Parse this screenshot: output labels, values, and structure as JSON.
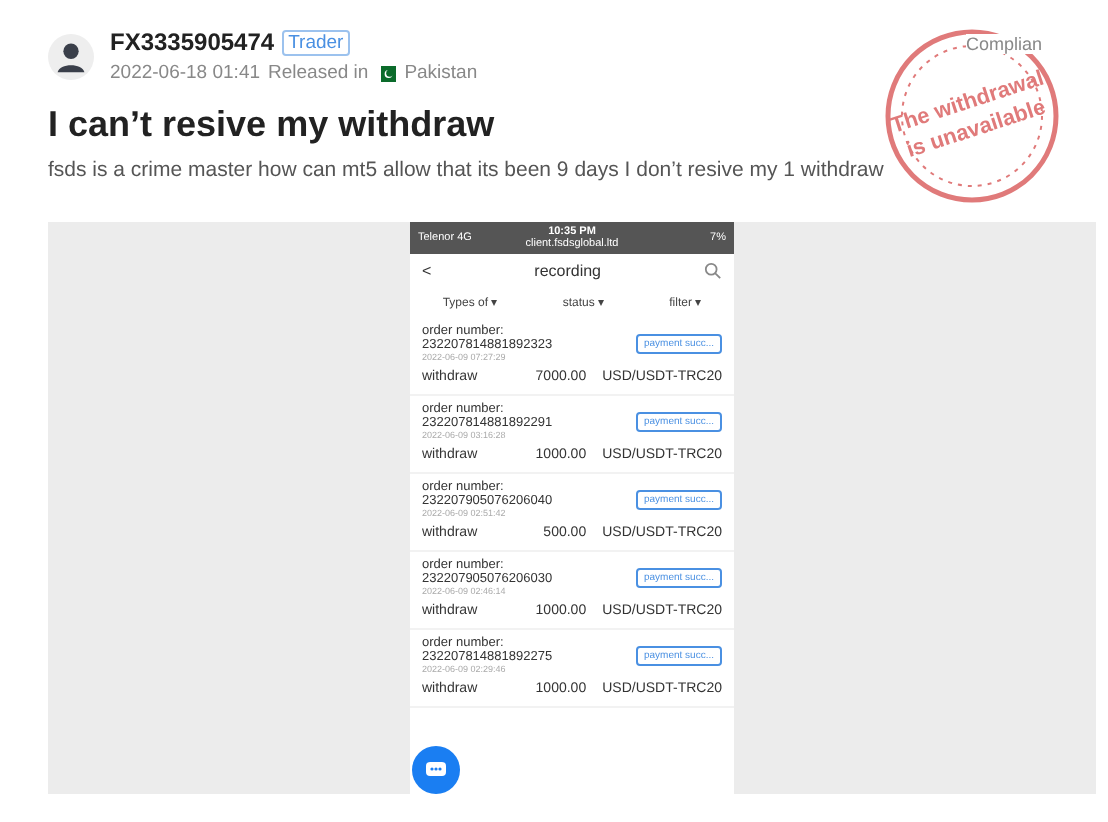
{
  "post": {
    "user": "FX3335905474",
    "badge": "Trader",
    "time": "2022-06-18 01:41",
    "released_label": "Released in",
    "country": "Pakistan",
    "category": "Complian",
    "stamp": [
      "The withdrawal",
      "is unavailable"
    ],
    "title": "I can’t resive my withdraw",
    "body": "fsds is a crime master how can mt5 allow that its been 9 days I don’t resive my 1 withdraw"
  },
  "phone": {
    "carrier": "Telenor  4G",
    "clock": "10:35 PM",
    "url": "client.fsdsglobal.ltd",
    "battery": "7%",
    "back": "<",
    "heading": "recording",
    "filters": [
      "Types of ▾",
      "status ▾",
      "filter ▾"
    ],
    "rows": [
      {
        "label": "order number:",
        "number": "232207814881892323",
        "date": "2022-06-09 07:27:29",
        "status": "payment succ...",
        "type": "withdraw",
        "amount": "7000.00",
        "currency": "USD/USDT-TRC20"
      },
      {
        "label": "order number:",
        "number": "232207814881892291",
        "date": "2022-06-09 03:16:28",
        "status": "payment succ...",
        "type": "withdraw",
        "amount": "1000.00",
        "currency": "USD/USDT-TRC20"
      },
      {
        "label": "order number:",
        "number": "232207905076206040",
        "date": "2022-06-09 02:51:42",
        "status": "payment succ...",
        "type": "withdraw",
        "amount": "500.00",
        "currency": "USD/USDT-TRC20"
      },
      {
        "label": "order number:",
        "number": "232207905076206030",
        "date": "2022-06-09 02:46:14",
        "status": "payment succ...",
        "type": "withdraw",
        "amount": "1000.00",
        "currency": "USD/USDT-TRC20"
      },
      {
        "label": "order number:",
        "number": "232207814881892275",
        "date": "2022-06-09 02:29:46",
        "status": "payment succ...",
        "type": "withdraw",
        "amount": "1000.00",
        "currency": "USD/USDT-TRC20"
      }
    ]
  }
}
